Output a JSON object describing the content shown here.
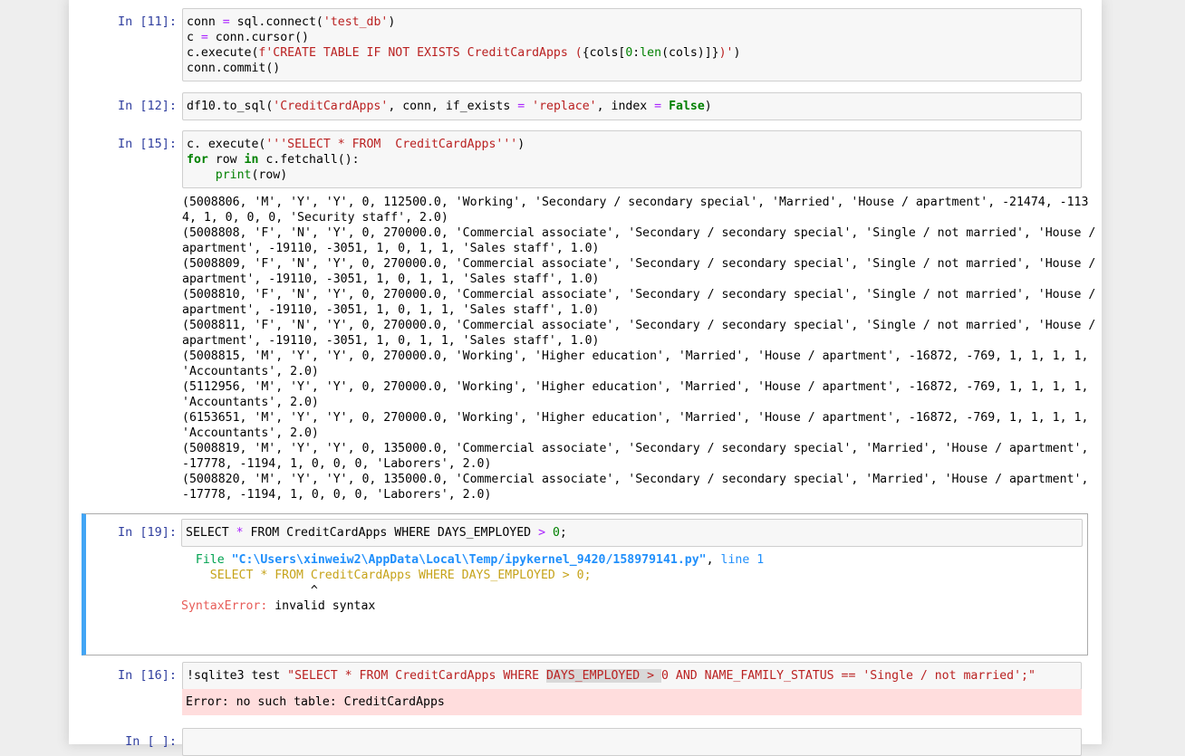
{
  "cells": [
    {
      "prompt": "In [11]:",
      "code": [
        [
          {
            "t": "conn "
          },
          {
            "t": "=",
            "c": "op"
          },
          {
            "t": " sql.connect("
          },
          {
            "t": "'test_db'",
            "c": "str"
          },
          {
            "t": ")"
          }
        ],
        [
          {
            "t": "c "
          },
          {
            "t": "=",
            "c": "op"
          },
          {
            "t": " conn.cursor()"
          }
        ],
        [
          {
            "t": "c.execute("
          },
          {
            "t": "f'CREATE TABLE IF NOT EXISTS CreditCardApps (",
            "c": "str"
          },
          {
            "t": "{cols["
          },
          {
            "t": "0",
            "c": "num"
          },
          {
            "t": ":"
          },
          {
            "t": "len",
            "c": "bi"
          },
          {
            "t": "(cols)]}"
          },
          {
            "t": ")'",
            "c": "str"
          },
          {
            "t": ")"
          }
        ],
        [
          {
            "t": "conn.commit()"
          }
        ]
      ]
    },
    {
      "prompt": "In [12]:",
      "code": [
        [
          {
            "t": "df10.to_sql("
          },
          {
            "t": "'CreditCardApps'",
            "c": "str"
          },
          {
            "t": ", conn, if_exists "
          },
          {
            "t": "=",
            "c": "op"
          },
          {
            "t": " "
          },
          {
            "t": "'replace'",
            "c": "str"
          },
          {
            "t": ", index "
          },
          {
            "t": "=",
            "c": "op"
          },
          {
            "t": " "
          },
          {
            "t": "False",
            "c": "kw"
          },
          {
            "t": ")"
          }
        ]
      ]
    },
    {
      "prompt": "In [15]:",
      "code": [
        [
          {
            "t": "c. execute("
          },
          {
            "t": "'''SELECT * FROM  CreditCardApps'''",
            "c": "str"
          },
          {
            "t": ")"
          }
        ],
        [
          {
            "t": "for",
            "c": "kw"
          },
          {
            "t": " row "
          },
          {
            "t": "in",
            "c": "kw"
          },
          {
            "t": " c.fetchall():"
          }
        ],
        [
          {
            "t": "    "
          },
          {
            "t": "print",
            "c": "bi"
          },
          {
            "t": "(row)"
          }
        ]
      ],
      "output_lines": [
        "(5008806, 'M', 'Y', 'Y', 0, 112500.0, 'Working', 'Secondary / secondary special', 'Married', 'House / apartment', -21474, -113",
        "4, 1, 0, 0, 0, 'Security staff', 2.0)",
        "(5008808, 'F', 'N', 'Y', 0, 270000.0, 'Commercial associate', 'Secondary / secondary special', 'Single / not married', 'House /",
        "apartment', -19110, -3051, 1, 0, 1, 1, 'Sales staff', 1.0)",
        "(5008809, 'F', 'N', 'Y', 0, 270000.0, 'Commercial associate', 'Secondary / secondary special', 'Single / not married', 'House /",
        "apartment', -19110, -3051, 1, 0, 1, 1, 'Sales staff', 1.0)",
        "(5008810, 'F', 'N', 'Y', 0, 270000.0, 'Commercial associate', 'Secondary / secondary special', 'Single / not married', 'House /",
        "apartment', -19110, -3051, 1, 0, 1, 1, 'Sales staff', 1.0)",
        "(5008811, 'F', 'N', 'Y', 0, 270000.0, 'Commercial associate', 'Secondary / secondary special', 'Single / not married', 'House /",
        "apartment', -19110, -3051, 1, 0, 1, 1, 'Sales staff', 1.0)",
        "(5008815, 'M', 'Y', 'Y', 0, 270000.0, 'Working', 'Higher education', 'Married', 'House / apartment', -16872, -769, 1, 1, 1, 1,",
        "'Accountants', 2.0)",
        "(5112956, 'M', 'Y', 'Y', 0, 270000.0, 'Working', 'Higher education', 'Married', 'House / apartment', -16872, -769, 1, 1, 1, 1,",
        "'Accountants', 2.0)",
        "(6153651, 'M', 'Y', 'Y', 0, 270000.0, 'Working', 'Higher education', 'Married', 'House / apartment', -16872, -769, 1, 1, 1, 1,",
        "'Accountants', 2.0)",
        "(5008819, 'M', 'Y', 'Y', 0, 135000.0, 'Commercial associate', 'Secondary / secondary special', 'Married', 'House / apartment',",
        "-17778, -1194, 1, 0, 0, 0, 'Laborers', 2.0)",
        "(5008820, 'M', 'Y', 'Y', 0, 135000.0, 'Commercial associate', 'Secondary / secondary special', 'Married', 'House / apartment',",
        "-17778, -1194, 1, 0, 0, 0, 'Laborers', 2.0)"
      ]
    },
    {
      "prompt": "In [19]:",
      "code": [
        [
          {
            "t": "SELECT "
          },
          {
            "t": "*",
            "c": "op"
          },
          {
            "t": " FROM CreditCardApps WHERE DAYS_EMPLOYED "
          },
          {
            "t": ">",
            "c": "op"
          },
          {
            "t": " "
          },
          {
            "t": "0",
            "c": "num"
          },
          {
            "t": ";"
          }
        ]
      ],
      "traceback": {
        "file_label": "  File",
        "path": "\"C:\\Users\\xinweiw2\\AppData\\Local\\Temp/ipykernel_9420/158979141.py\"",
        "line_sep": ", ",
        "line_label": "line 1",
        "code_line": "    SELECT * FROM CreditCardApps WHERE DAYS_EMPLOYED > 0;",
        "caret_line": "                  ^",
        "error_name": "SyntaxError:",
        "error_msg": " invalid syntax"
      }
    },
    {
      "prompt": "In [16]:",
      "code": [
        [
          {
            "t": "!sqlite3 test ",
            "c": "kw2"
          },
          {
            "t": "\"SELECT * FROM CreditCardApps WHERE ",
            "c": "str"
          },
          {
            "t": "DAYS_EMPLOYED > ",
            "c": "str hl"
          },
          {
            "t": "0 AND NAME_FAMILY_STATUS == 'Single / not married';\"",
            "c": "str"
          }
        ]
      ],
      "error_output": "Error: no such table: CreditCardApps"
    },
    {
      "prompt": "In [ ]:",
      "code": []
    }
  ]
}
